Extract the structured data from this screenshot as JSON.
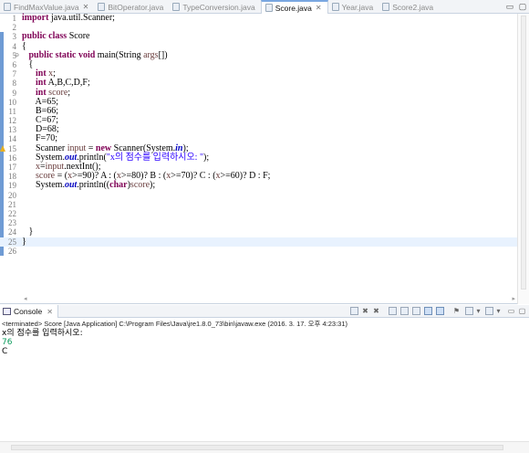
{
  "tabs": [
    {
      "label": "FindMaxValue.java",
      "active": false,
      "close": "✕"
    },
    {
      "label": "BitOperator.java",
      "active": false,
      "close": ""
    },
    {
      "label": "TypeConversion.java",
      "active": false,
      "close": ""
    },
    {
      "label": "Score.java",
      "active": true,
      "close": "✕"
    },
    {
      "label": "Year.java",
      "active": false,
      "close": ""
    },
    {
      "label": "Score2.java",
      "active": false,
      "close": ""
    }
  ],
  "tabbar": {
    "minimize": "▭",
    "maximize": "▢"
  },
  "editor": {
    "line_numbers": [
      "1",
      "2",
      "3",
      "4",
      "5",
      "6",
      "7",
      "8",
      "9",
      "10",
      "11",
      "12",
      "13",
      "14",
      "15",
      "16",
      "17",
      "18",
      "19",
      "20",
      "21",
      "22",
      "23",
      "24",
      "25",
      "26"
    ],
    "fold_marker": "⊖",
    "scroll_left": "◂",
    "scroll_right": "▸"
  },
  "console": {
    "tab_label": "Console",
    "close": "✕",
    "terminated": "<terminated> Score [Java Application] C:\\Program Files\\Java\\jre1.8.0_73\\bin\\javaw.exe (2016. 3. 17. 오후 4:23:31)",
    "output": [
      "x의 점수를 입력하시오:",
      "76",
      "C"
    ]
  },
  "colors": {
    "keyword": "#7f0055",
    "string": "#2a00ff",
    "field": "#0000c0",
    "variable": "#6a3e3e",
    "accent": "#6f9bd4"
  }
}
